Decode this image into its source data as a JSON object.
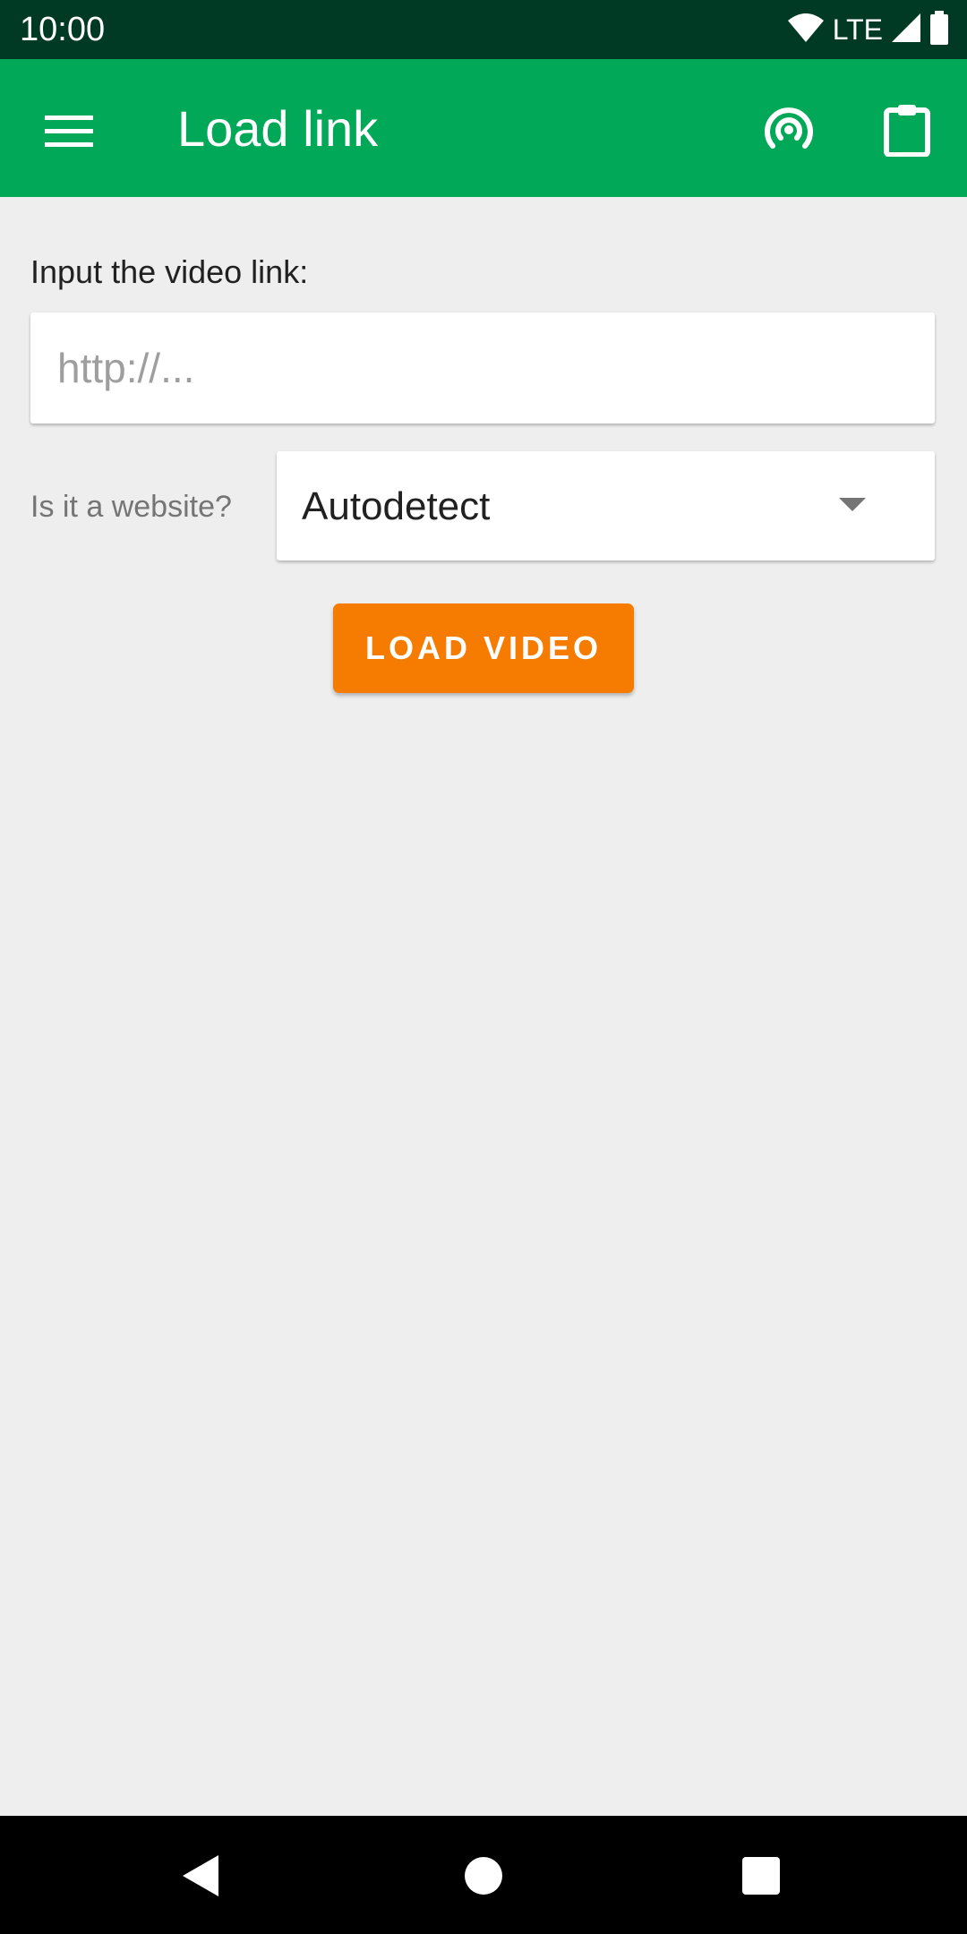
{
  "status_bar": {
    "time": "10:00",
    "network": "LTE",
    "icons": [
      "wifi-icon",
      "cell-signal-icon",
      "battery-icon"
    ]
  },
  "app_bar": {
    "title": "Load link",
    "icons": [
      "menu-icon",
      "cast-icon",
      "clipboard-icon"
    ]
  },
  "form": {
    "input_label": "Input the video link:",
    "input_value": "",
    "input_placeholder": "http://...",
    "website_label": "Is it a website?",
    "website_selected": "Autodetect",
    "load_button": "LOAD VIDEO"
  },
  "nav_bar": {
    "icons": [
      "back-icon",
      "home-icon",
      "recents-icon"
    ]
  },
  "colors": {
    "status_bar": "#003a24",
    "app_bar": "#00a857",
    "background": "#eeeeee",
    "accent_button": "#f57c00",
    "nav_bar": "#000000"
  }
}
